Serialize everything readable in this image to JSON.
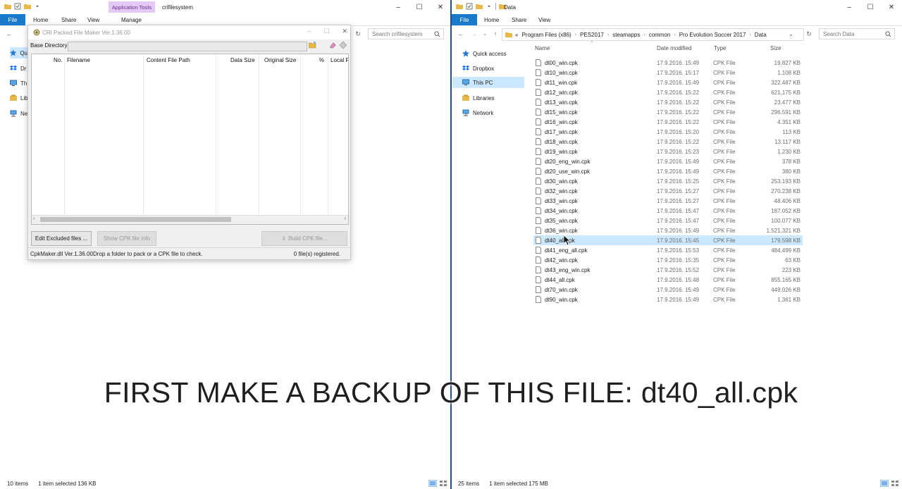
{
  "left_window": {
    "title": "crifilesystem",
    "context_group": "Application Tools",
    "ribbon_tabs": {
      "file": "File",
      "home": "Home",
      "share": "Share",
      "view": "View",
      "manage": "Manage"
    },
    "search_placeholder": "Search crifilesystem",
    "nav_items": [
      "Qu",
      "Dr",
      "Th",
      "Lib",
      "Ne"
    ],
    "status_items": "10 items",
    "status_selected": "1 item selected  136 KB"
  },
  "cri_dialog": {
    "title": "CRI Packed File Maker Ver.1.36.00",
    "base_dir_label": "Base Directory",
    "base_dir_value": "",
    "columns": [
      "No.",
      "Filename",
      "Content File Path",
      "Data Size",
      "Original Size",
      "%",
      "Local F"
    ],
    "buttons": {
      "edit_excluded": "Edit Excluded files ...",
      "show_cpk_info": "Show CPK file info",
      "build_cpk": "Build CPK file..."
    },
    "status_version": "CpkMaker.dll Ver.1.36.00",
    "status_hint": "Drop a folder to pack or a CPK file to check.",
    "status_count": "0 file(s) registered."
  },
  "right_window": {
    "title": "Data",
    "ribbon_tabs": {
      "file": "File",
      "home": "Home",
      "share": "Share",
      "view": "View"
    },
    "breadcrumb": [
      "«",
      "Program Files (x86)",
      "PES2017",
      "steamapps",
      "common",
      "Pro Evolution Soccer 2017",
      "Data"
    ],
    "search_placeholder": "Search Data",
    "nav": {
      "quick_access": "Quick access",
      "dropbox": "Dropbox",
      "this_pc": "This PC",
      "libraries": "Libraries",
      "network": "Network"
    },
    "columns": {
      "name": "Name",
      "date": "Date modified",
      "type": "Type",
      "size": "Size"
    },
    "files": [
      {
        "name": "dt00_win.cpk",
        "date": "17.9.2016. 15:49",
        "type": "CPK File",
        "size": "19.827 KB"
      },
      {
        "name": "dt10_win.cpk",
        "date": "17.9.2016. 15:17",
        "type": "CPK File",
        "size": "1.108 KB"
      },
      {
        "name": "dt11_win.cpk",
        "date": "17.9.2016. 15:49",
        "type": "CPK File",
        "size": "322.487 KB"
      },
      {
        "name": "dt12_win.cpk",
        "date": "17.9.2016. 15:22",
        "type": "CPK File",
        "size": "621.175 KB"
      },
      {
        "name": "dt13_win.cpk",
        "date": "17.9.2016. 15:22",
        "type": "CPK File",
        "size": "23.477 KB"
      },
      {
        "name": "dt15_win.cpk",
        "date": "17.9.2016. 15:22",
        "type": "CPK File",
        "size": "296.591 KB"
      },
      {
        "name": "dt16_win.cpk",
        "date": "17.9.2016. 15:22",
        "type": "CPK File",
        "size": "4.351 KB"
      },
      {
        "name": "dt17_win.cpk",
        "date": "17.9.2016. 15:20",
        "type": "CPK File",
        "size": "113 KB"
      },
      {
        "name": "dt18_win.cpk",
        "date": "17.9.2016. 15:22",
        "type": "CPK File",
        "size": "13.117 KB"
      },
      {
        "name": "dt19_win.cpk",
        "date": "17.9.2016. 15:23",
        "type": "CPK File",
        "size": "1.230 KB"
      },
      {
        "name": "dt20_eng_win.cpk",
        "date": "17.9.2016. 15:49",
        "type": "CPK File",
        "size": "378 KB"
      },
      {
        "name": "dt20_use_win.cpk",
        "date": "17.9.2016. 15:49",
        "type": "CPK File",
        "size": "380 KB"
      },
      {
        "name": "dt30_win.cpk",
        "date": "17.9.2016. 15:25",
        "type": "CPK File",
        "size": "253.193 KB"
      },
      {
        "name": "dt32_win.cpk",
        "date": "17.9.2016. 15:27",
        "type": "CPK File",
        "size": "270.238 KB"
      },
      {
        "name": "dt33_win.cpk",
        "date": "17.9.2016. 15:27",
        "type": "CPK File",
        "size": "48.406 KB"
      },
      {
        "name": "dt34_win.cpk",
        "date": "17.9.2016. 15:47",
        "type": "CPK File",
        "size": "187.052 KB"
      },
      {
        "name": "dt35_win.cpk",
        "date": "17.9.2016. 15:47",
        "type": "CPK File",
        "size": "100.077 KB"
      },
      {
        "name": "dt36_win.cpk",
        "date": "17.9.2016. 15:49",
        "type": "CPK File",
        "size": "1.521.321 KB"
      },
      {
        "name": "dt40_all.cpk",
        "date": "17.9.2016. 15:45",
        "type": "CPK File",
        "size": "179.598 KB"
      },
      {
        "name": "dt41_eng_all.cpk",
        "date": "17.9.2016. 15:53",
        "type": "CPK File",
        "size": "484.499 KB"
      },
      {
        "name": "dt42_win.cpk",
        "date": "17.9.2016. 15:35",
        "type": "CPK File",
        "size": "63 KB"
      },
      {
        "name": "dt43_eng_win.cpk",
        "date": "17.9.2016. 15:52",
        "type": "CPK File",
        "size": "223 KB"
      },
      {
        "name": "dt44_all.cpk",
        "date": "17.9.2016. 15:48",
        "type": "CPK File",
        "size": "855.165 KB"
      },
      {
        "name": "dt70_win.cpk",
        "date": "17.9.2016. 15:49",
        "type": "CPK File",
        "size": "449.026 KB"
      },
      {
        "name": "dt90_win.cpk",
        "date": "17.9.2016. 15:49",
        "type": "CPK File",
        "size": "1.361 KB"
      }
    ],
    "selected_file": "dt40_all.cpk",
    "status_items": "25 items",
    "status_selected": "1 item selected  175 MB"
  },
  "caption": "FIRST MAKE A BACKUP OF THIS FILE: dt40_all.cpk",
  "colors": {
    "accent": "#1979ca",
    "selection": "#cce8ff",
    "context_tab": "#e3c9f5",
    "divider": "#1f4e99"
  }
}
